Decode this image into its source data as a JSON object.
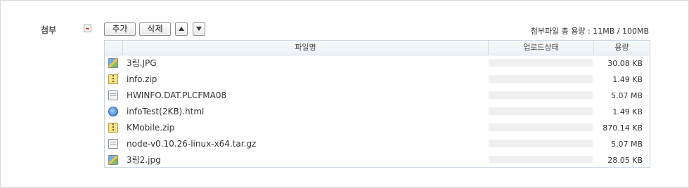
{
  "attachment": {
    "label": "첨부",
    "buttons": {
      "add_label": "추가",
      "delete_label": "삭제"
    },
    "total_size_text": "첨부파일 총 용량 : 11MB / 100MB",
    "table": {
      "headers": {
        "name": "파일명",
        "status": "업로드상태",
        "size": "용량"
      },
      "rows": [
        {
          "icon": "image-file-icon",
          "name": "3림.JPG",
          "size": "30.08 KB"
        },
        {
          "icon": "zip-file-icon",
          "name": "info.zip",
          "size": "1.49 KB"
        },
        {
          "icon": "generic-file-icon",
          "name": "HWINFO.DAT.PLCFMA08",
          "size": "5.07 MB"
        },
        {
          "icon": "html-file-icon",
          "name": "infoTest(2KB).html",
          "size": "1.49 KB"
        },
        {
          "icon": "zip-file-icon",
          "name": "KMobile.zip",
          "size": "870.14 KB"
        },
        {
          "icon": "generic-file-icon",
          "name": "node-v0.10.26-linux-x64.tar.gz",
          "size": "5.07 MB"
        },
        {
          "icon": "image-file-icon",
          "name": "3림2.jpg",
          "size": "28.05 KB"
        }
      ]
    }
  }
}
